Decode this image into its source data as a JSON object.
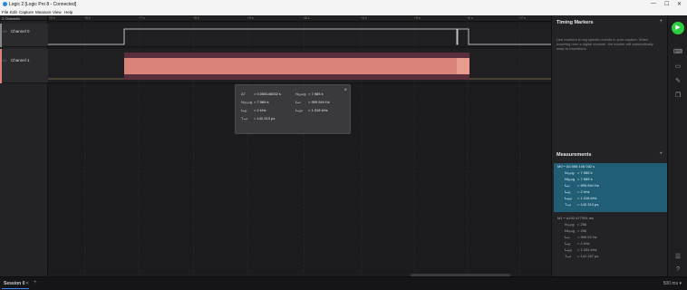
{
  "app": {
    "title": "Logic 2 [Logic Pro 8 - Connected]",
    "window_controls": [
      "—",
      "☐",
      "✕"
    ]
  },
  "menu": [
    "File",
    "Edit",
    "Capture",
    "Measure",
    "View",
    "Help"
  ],
  "channels_header": "2 Channels",
  "channels": [
    {
      "num": "00",
      "name": "Channel 0"
    },
    {
      "num": "01",
      "name": "Channel 1"
    }
  ],
  "ruler_labels": [
    "+0 s",
    "+6 s",
    "+7 s",
    "+8 s",
    "+9 s",
    "+4 s",
    "+5 s",
    "+6 s",
    "+7 s"
  ],
  "ruler_top_label": "46 s",
  "tooltip": {
    "dt_label": "ΔT",
    "dt_val": "= 0.058146032 s",
    "nrise_label": "N₀ᵣᵢₛᵢₙg",
    "nrise_val": "= 7.985 k",
    "nfall_label": "Nₓₐₗₗᵢₙg",
    "nfall_val": "= 7.985 k",
    "fmin_label": "fₘᵢₙ",
    "fmin_val": "= 999.944 Hz",
    "fmax_label": "fₘₐₓ",
    "fmax_val": "= 2 kHz",
    "fmean_label": "fₘₑₐₙ",
    "fmean_val": "= 1.318 kHz",
    "tmin_label": "Tₘᵢₙ",
    "tmin_val": "= 142.313 μs",
    "close": "⊗"
  },
  "timing_markers": {
    "title": "Timing Markers",
    "help": "Use markers to tag specific events in your capture. When hovering over a digital channel, the marker will automatically snap to transitions."
  },
  "measurements": {
    "title": "Measurements",
    "m0": {
      "head": "M0 ⎯ Δ0.058 146 032 s",
      "lines": [
        {
          "k": "Nᵣᵢₛᵢₙg",
          "v": "= 7.985 k"
        },
        {
          "k": "Nfₐₗₗᵢₙg",
          "v": "= 7.985 k"
        },
        {
          "k": "fₘᵢₙ",
          "v": "= 999.944 Hz"
        },
        {
          "k": "fₘₐₓ",
          "v": "= 2 kHz"
        },
        {
          "k": "fₘₑₐₙ",
          "v": "= 1.318 kHz"
        },
        {
          "k": "Tₘᵢₙ",
          "v": "= 142.313 μs"
        }
      ]
    },
    "m1": {
      "head": "M1 ⎯ Δ192.477994 ms",
      "lines": [
        {
          "k": "Nᵣᵢₛᵢₙg",
          "v": "= 256"
        },
        {
          "k": "Nfₐₗₗᵢₙg",
          "v": "= 256"
        },
        {
          "k": "fₘᵢₙ",
          "v": "= 999.92 Hz"
        },
        {
          "k": "fₘₐₓ",
          "v": "= 2 kHz"
        },
        {
          "k": "fₘₑₐₙ",
          "v": "= 1.334 kHz"
        },
        {
          "k": "Tₘᵢₙ",
          "v": "= 142.157 μs"
        }
      ]
    }
  },
  "status": {
    "session": "Session 0",
    "close": "✕",
    "add": "+",
    "rate": "500 ms ▾"
  },
  "colors": {
    "channel0": "#e8e8e8",
    "channel1_fill": "#d9837a",
    "channel1_band": "#5a2e3a",
    "accent": "#1f6f8b",
    "run": "#2ecc40"
  },
  "icons": {
    "run": "play-icon",
    "rail": [
      "keyboard-icon",
      "chat-icon",
      "ruler-icon",
      "layers-icon"
    ]
  }
}
